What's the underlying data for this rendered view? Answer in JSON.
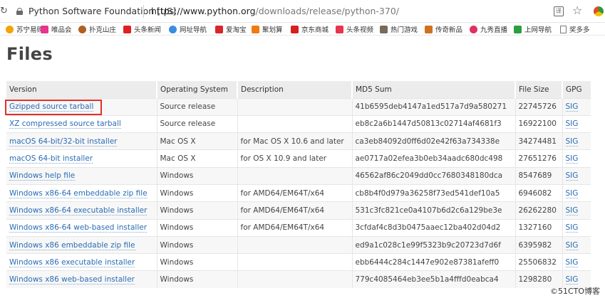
{
  "browser": {
    "site_name": "Python Software Foundation [US]",
    "url_host": "https://www.python.org",
    "url_path": "/downloads/release/python-370/"
  },
  "bookmarks": [
    {
      "label": "苏宁易购",
      "icon": "suning-icon",
      "color": "#f5a300",
      "round": true
    },
    {
      "label": "唯品会",
      "icon": "vip-icon",
      "color": "#e8348c",
      "round": false
    },
    {
      "label": "扑克山庄",
      "icon": "poker-icon",
      "color": "#b06020",
      "round": true
    },
    {
      "label": "头条新闻",
      "icon": "toutiao-news-icon",
      "color": "#e02020",
      "round": false
    },
    {
      "label": "网址导航",
      "icon": "globe-icon",
      "color": "#3a8de0",
      "round": true
    },
    {
      "label": "爱淘宝",
      "icon": "aitaobao-icon",
      "color": "#d8262c",
      "round": false
    },
    {
      "label": "聚划算",
      "icon": "juhuasuan-icon",
      "color": "#f07a10",
      "round": false
    },
    {
      "label": "京东商城",
      "icon": "jd-icon",
      "color": "#d42020",
      "round": false
    },
    {
      "label": "头条视频",
      "icon": "video-play-icon",
      "color": "#e8344c",
      "round": false
    },
    {
      "label": "热门游戏",
      "icon": "game-icon",
      "color": "#7a6a5a",
      "round": false
    },
    {
      "label": "传奇新品",
      "icon": "legend-game-icon",
      "color": "#d07020",
      "round": false
    },
    {
      "label": "九秀直播",
      "icon": "location-pin-icon",
      "color": "#e03060",
      "round": true
    },
    {
      "label": "上网导航",
      "icon": "nav-icon",
      "color": "#2aa040",
      "round": false
    },
    {
      "label": "奖多多",
      "icon": "document-icon",
      "color": "#ffffff",
      "round": false,
      "doc": true
    }
  ],
  "page": {
    "title": "Files"
  },
  "table": {
    "headers": [
      "Version",
      "Operating System",
      "Description",
      "MD5 Sum",
      "File Size",
      "GPG"
    ],
    "rows": [
      {
        "version": "Gzipped source tarball",
        "os": "Source release",
        "description": "",
        "md5": "41b6595deb4147a1ed517a7d9a580271",
        "size": "22745726",
        "gpg": "SIG"
      },
      {
        "version": "XZ compressed source tarball",
        "os": "Source release",
        "description": "",
        "md5": "eb8c2a6b1447d50813c02714af4681f3",
        "size": "16922100",
        "gpg": "SIG"
      },
      {
        "version": "macOS 64-bit/32-bit installer",
        "os": "Mac OS X",
        "description": "for Mac OS X 10.6 and later",
        "md5": "ca3eb84092d0ff6d02e42f63a734338e",
        "size": "34274481",
        "gpg": "SIG"
      },
      {
        "version": "macOS 64-bit installer",
        "os": "Mac OS X",
        "description": "for OS X 10.9 and later",
        "md5": "ae0717a02efea3b0eb34aadc680dc498",
        "size": "27651276",
        "gpg": "SIG"
      },
      {
        "version": "Windows help file",
        "os": "Windows",
        "description": "",
        "md5": "46562af86c2049dd0cc7680348180dca",
        "size": "8547689",
        "gpg": "SIG"
      },
      {
        "version": "Windows x86-64 embeddable zip file",
        "os": "Windows",
        "description": "for AMD64/EM64T/x64",
        "md5": "cb8b4f0d979a36258f73ed541def10a5",
        "size": "6946082",
        "gpg": "SIG"
      },
      {
        "version": "Windows x86-64 executable installer",
        "os": "Windows",
        "description": "for AMD64/EM64T/x64",
        "md5": "531c3fc821ce0a4107b6d2c6a129be3e",
        "size": "26262280",
        "gpg": "SIG"
      },
      {
        "version": "Windows x86-64 web-based installer",
        "os": "Windows",
        "description": "for AMD64/EM64T/x64",
        "md5": "3cfdaf4c8d3b0475aaec12ba402d04d2",
        "size": "1327160",
        "gpg": "SIG"
      },
      {
        "version": "Windows x86 embeddable zip file",
        "os": "Windows",
        "description": "",
        "md5": "ed9a1c028c1e99f5323b9c20723d7d6f",
        "size": "6395982",
        "gpg": "SIG"
      },
      {
        "version": "Windows x86 executable installer",
        "os": "Windows",
        "description": "",
        "md5": "ebb6444c284c1447e902e87381afeff0",
        "size": "25506832",
        "gpg": "SIG"
      },
      {
        "version": "Windows x86 web-based installer",
        "os": "Windows",
        "description": "",
        "md5": "779c4085464eb3ee5b1a4fffd0eabca4",
        "size": "1298280",
        "gpg": "SIG"
      }
    ]
  },
  "watermark": "©51CTO博客",
  "colors": {
    "link": "#2a6cb3",
    "highlight_box": "#e0302a",
    "header_bg": "#ececec"
  }
}
